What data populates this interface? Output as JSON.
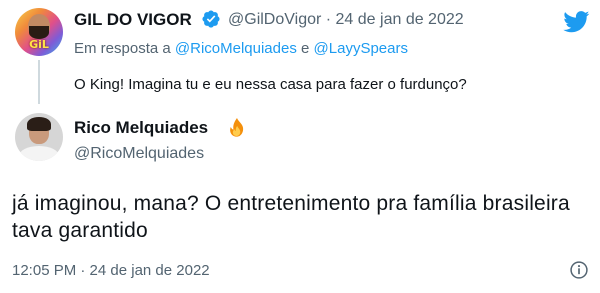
{
  "parent_tweet": {
    "display_name": "GIL DO VIGOR",
    "handle": "@GilDoVigor",
    "date": "24 de jan de 2022",
    "meta_separator": " · ",
    "avatar_text": "GiL",
    "reply_prefix": "Em resposta a",
    "reply_to_1": "@RicoMelquiades",
    "reply_conjunction": "e",
    "reply_to_2": "@LayySpears",
    "text": "O King! Imagina tu e eu nessa casa para fazer o furdunço?"
  },
  "reply_tweet": {
    "display_name": "Rico Melquiades",
    "handle": "@RicoMelquiades",
    "text": "já imaginou, mana? O entretenimento pra família brasileira tava garantido",
    "timestamp": "12:05 PM · 24 de jan de 2022"
  },
  "icons": {
    "verified": "verified-badge-icon",
    "twitter": "twitter-bird-icon",
    "fire": "fire-emoji-icon",
    "info": "info-icon"
  },
  "colors": {
    "brand_blue": "#1d9bf0",
    "secondary_text": "#536471",
    "primary_text": "#0f1419"
  }
}
